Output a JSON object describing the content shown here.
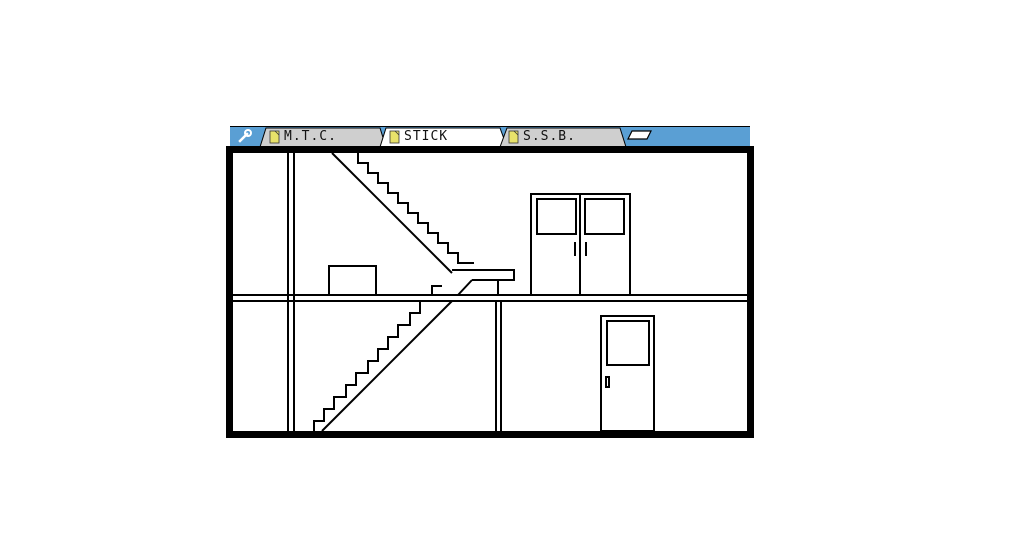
{
  "tabs": [
    {
      "label": "M.T.C.",
      "icon": "document-icon",
      "active": false
    },
    {
      "label": "STICK",
      "icon": "document-icon",
      "active": true
    },
    {
      "label": "S.S.B.",
      "icon": "document-icon",
      "active": false
    }
  ],
  "toolbar": {
    "settings_icon": "wrench-icon",
    "new_tab_icon": "new-tab-icon"
  },
  "colors": {
    "tabbar_bg": "#5a9fd4",
    "tab_inactive": "#cfcfcf",
    "tab_active": "#ffffff",
    "doc_icon": "#e8e26a",
    "ink": "#000000",
    "canvas": "#ffffff"
  },
  "scene": {
    "description_icons": [
      "staircase",
      "double-door",
      "single-door",
      "box",
      "floor-divider",
      "pillar"
    ]
  }
}
